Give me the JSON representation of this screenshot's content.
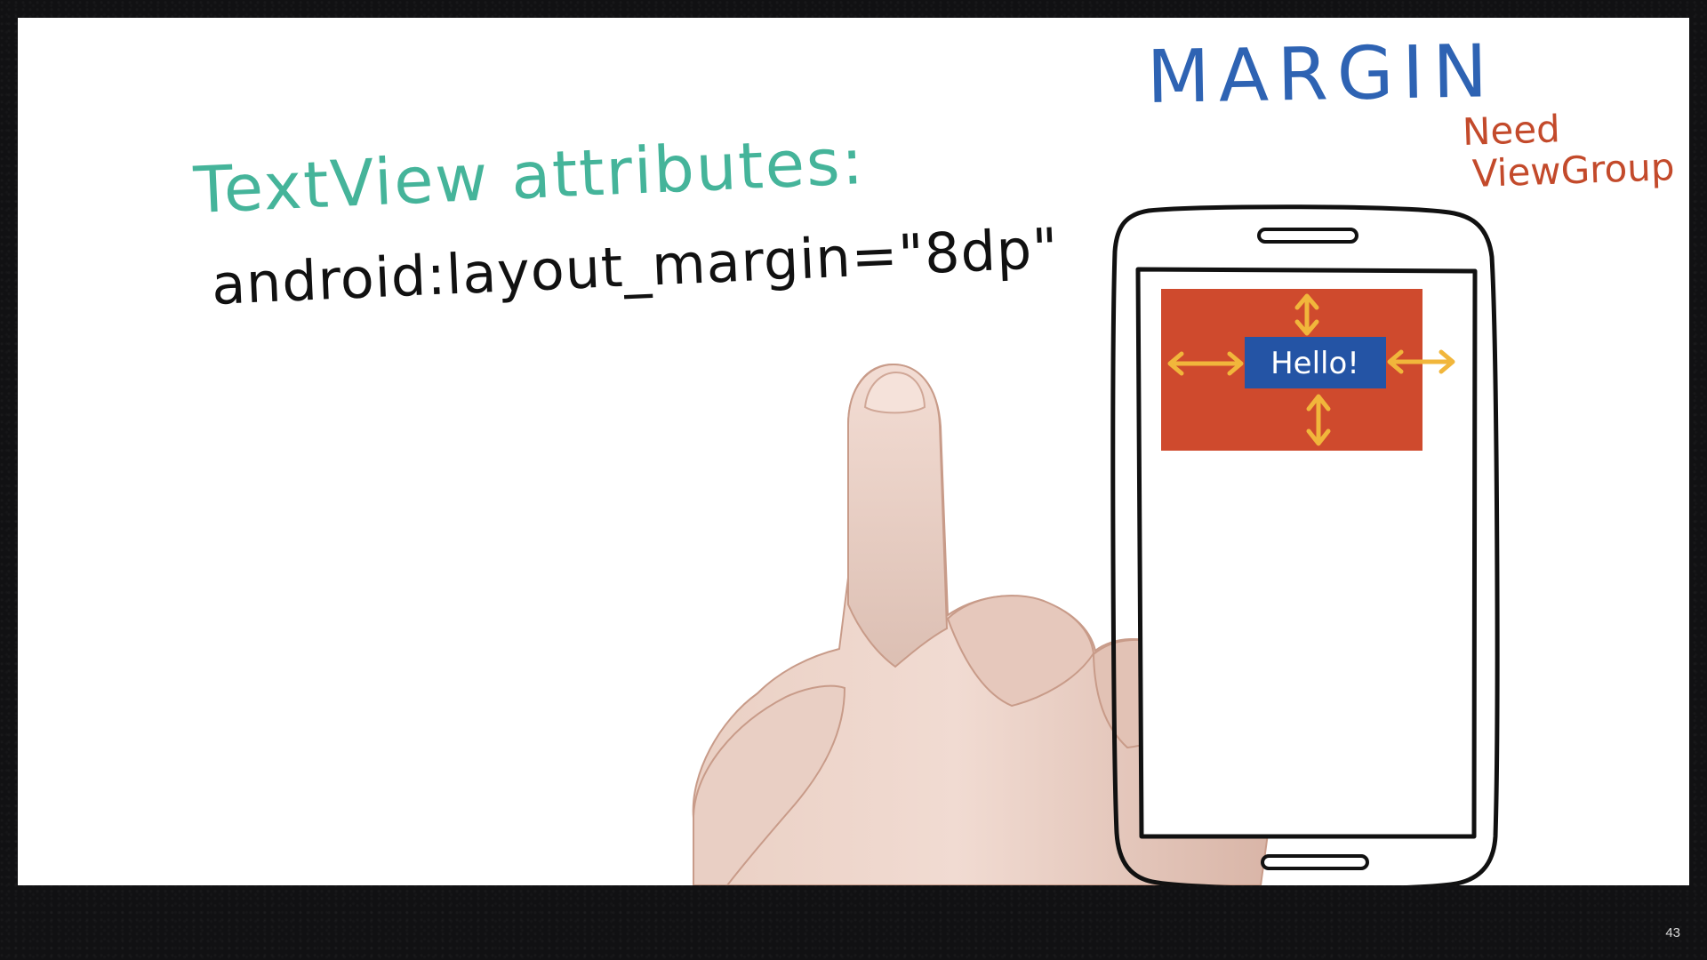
{
  "slide": {
    "heading": "TextView attributes:",
    "code": "android:layout_margin=\"8dp\"",
    "topic": "MARGIN",
    "note_line_1": "Need",
    "note_line_2": "ViewGroup",
    "phone_label": "Hello!",
    "number": "43"
  },
  "colors": {
    "heading": "#45b49a",
    "topic": "#2e63b3",
    "note": "#c34a2b",
    "container": "#cf4a2d",
    "label_background": "#2454a5",
    "arrows": "#f1b63b"
  },
  "icons": {
    "hand": "pointing-hand-illustration",
    "phone": "phone-outline-illustration",
    "arrows": "margin-arrow-icon"
  }
}
